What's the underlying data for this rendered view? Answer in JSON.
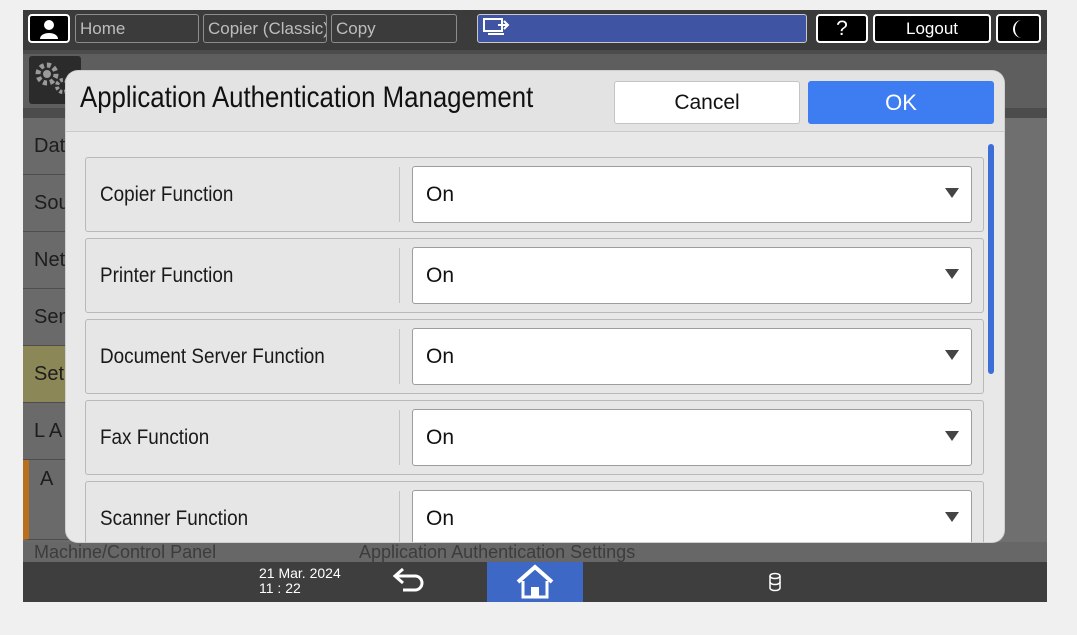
{
  "topbar": {
    "home_label": "Home",
    "tab1_label": "Copier (Classic)",
    "tab2_label": "Copy",
    "help_label": "?",
    "logout_label": "Logout"
  },
  "background": {
    "list_items": [
      "Dat",
      "Sou",
      "Net",
      "Sen",
      "Set",
      "L A",
      "A",
      "Machine/Control Panel"
    ],
    "under_text": "Application Authentication Settings"
  },
  "dialog": {
    "title": "Application Authentication Management",
    "cancel_label": "Cancel",
    "ok_label": "OK",
    "rows": [
      {
        "label": "Copier Function",
        "value": "On"
      },
      {
        "label": "Printer Function",
        "value": "On"
      },
      {
        "label": "Document Server Function",
        "value": "On"
      },
      {
        "label": "Fax Function",
        "value": "On"
      },
      {
        "label": "Scanner Function",
        "value": "On"
      }
    ]
  },
  "bottombar": {
    "date": "21 Mar. 2024",
    "time": "11 : 22"
  },
  "colors": {
    "accent": "#3d7cf1",
    "home_active": "#3d68c6",
    "highlight_row": "#8c8757"
  },
  "icons": [
    "user-icon",
    "screen-share-icon",
    "moon-icon",
    "gear-icon",
    "back-arrow-icon",
    "home-icon",
    "storage-icon",
    "dropdown-arrow-icon"
  ]
}
